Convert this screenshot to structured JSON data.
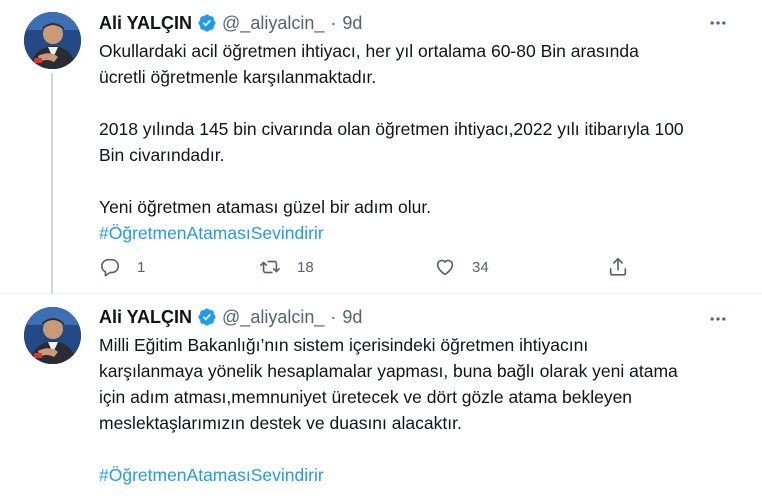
{
  "tweets": [
    {
      "author_name": "Ali YALÇIN",
      "handle": "@_aliyalcin_",
      "separator": "·",
      "time": "9d",
      "verified": true,
      "avatar_icon": "profile-photo",
      "paragraphs": [
        "Okullardaki acil öğretmen ihtiyacı, her yıl ortalama 60-80 Bin arasında\nücretli öğretmenle karşılanmaktadır.",
        "2018 yılında 145 bin civarında olan öğretmen ihtiyacı,2022 yılı itibarıyla 100\nBin civarındadır.",
        "Yeni öğretmen ataması güzel bir adım olur."
      ],
      "hashtag": "#ÖğretmenAtamasıSevindirir",
      "replies": "1",
      "retweets": "18",
      "likes": "34"
    },
    {
      "author_name": "Ali YALÇIN",
      "handle": "@_aliyalcin_",
      "separator": "·",
      "time": "9d",
      "verified": true,
      "avatar_icon": "profile-photo",
      "paragraphs": [
        "Milli Eğitim Bakanlığı’nın sistem içerisindeki öğretmen ihtiyacını\nkarşılanmaya yönelik hesaplamalar yapması, buna bağlı olarak yeni atama\niçin adım atması,memnuniyet üretecek ve dört gözle atama bekleyen\nmeslektaşlarımızın destek ve duasını alacaktır."
      ],
      "hashtag": "#ÖğretmenAtamasıSevindirir"
    }
  ],
  "colors": {
    "text": "#0f1419",
    "secondary": "#536471",
    "accent": "#1d9bf0",
    "divider": "#eff3f4",
    "thread_line": "#cfd9de"
  }
}
